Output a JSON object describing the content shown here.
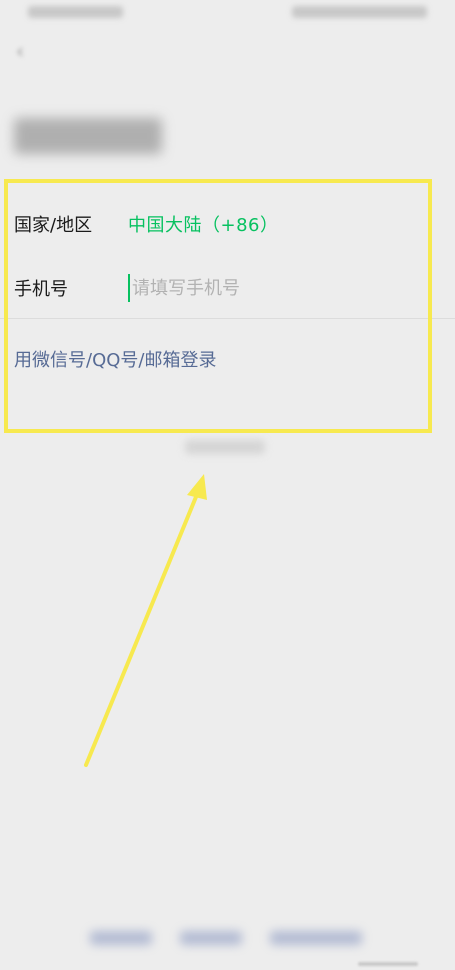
{
  "form": {
    "region_label": "国家/地区",
    "region_value": "中国大陆（+86）",
    "phone_label": "手机号",
    "phone_value": "",
    "phone_placeholder": "请填写手机号"
  },
  "alt_login_link": "用微信号/QQ号/邮箱登录",
  "icons": {
    "back": "back-arrow-icon"
  },
  "colors": {
    "accent_green": "#07c160",
    "link_blue": "#576b95",
    "highlight_yellow": "#f7e94f",
    "background": "#ededed"
  }
}
